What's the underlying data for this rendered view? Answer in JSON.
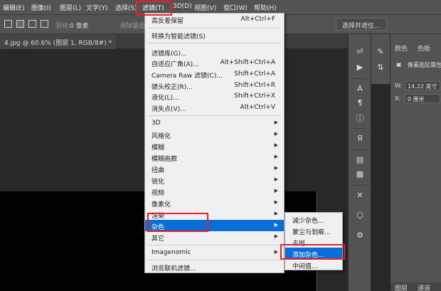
{
  "menubar": {
    "items": [
      "编辑(E)",
      "图像(I)",
      "图层(L)",
      "文字(Y)",
      "选择(S)",
      "滤镜(T)",
      "3D(D)",
      "视图(V)",
      "窗口(W)",
      "帮助(H)"
    ]
  },
  "options": {
    "feather_label": "羽化:",
    "feather_value": "0 像素",
    "antialias_label": "消除锯齿",
    "select_mask_button": "选择并遮住..."
  },
  "document": {
    "tab_title": "4.jpg @ 60.6% (图层 1, RGB/8#) *"
  },
  "filter_menu": {
    "items": [
      {
        "label": "高反差保留",
        "shortcut": "Alt+Ctrl+F"
      },
      {
        "label": "转换为智能滤镜(S)"
      },
      {
        "label": "滤镜库(G)..."
      },
      {
        "label": "自适应广角(A)...",
        "shortcut": "Alt+Shift+Ctrl+A"
      },
      {
        "label": "Camera Raw 滤镜(C)...",
        "shortcut": "Shift+Ctrl+A"
      },
      {
        "label": "镜头校正(R)...",
        "shortcut": "Shift+Ctrl+R"
      },
      {
        "label": "液化(L)...",
        "shortcut": "Shift+Ctrl+X"
      },
      {
        "label": "消失点(V)...",
        "shortcut": "Alt+Ctrl+V"
      },
      {
        "label": "3D"
      },
      {
        "label": "风格化"
      },
      {
        "label": "模糊"
      },
      {
        "label": "模糊画廊"
      },
      {
        "label": "扭曲"
      },
      {
        "label": "锐化"
      },
      {
        "label": "视频"
      },
      {
        "label": "像素化"
      },
      {
        "label": "渲染"
      },
      {
        "label": "杂色"
      },
      {
        "label": "其它"
      },
      {
        "label": "Imagenomic"
      },
      {
        "label": "浏览联机滤镜..."
      }
    ]
  },
  "noise_submenu": {
    "items": [
      "减少杂色...",
      "蒙尘与划痕...",
      "去斑",
      "添加杂色...",
      "中间值..."
    ]
  },
  "right_panel": {
    "tabs": [
      "颜色",
      "色板"
    ],
    "properties_title": "像素图层属性",
    "w_label": "W:",
    "w_value": "14.22 英寸",
    "x_label": "X:",
    "x_value": "0 厘米",
    "bottom_tabs": [
      "图层",
      "通道"
    ]
  },
  "colors": {
    "highlight": "#0a6ed8",
    "annotation": "#e8202a"
  }
}
